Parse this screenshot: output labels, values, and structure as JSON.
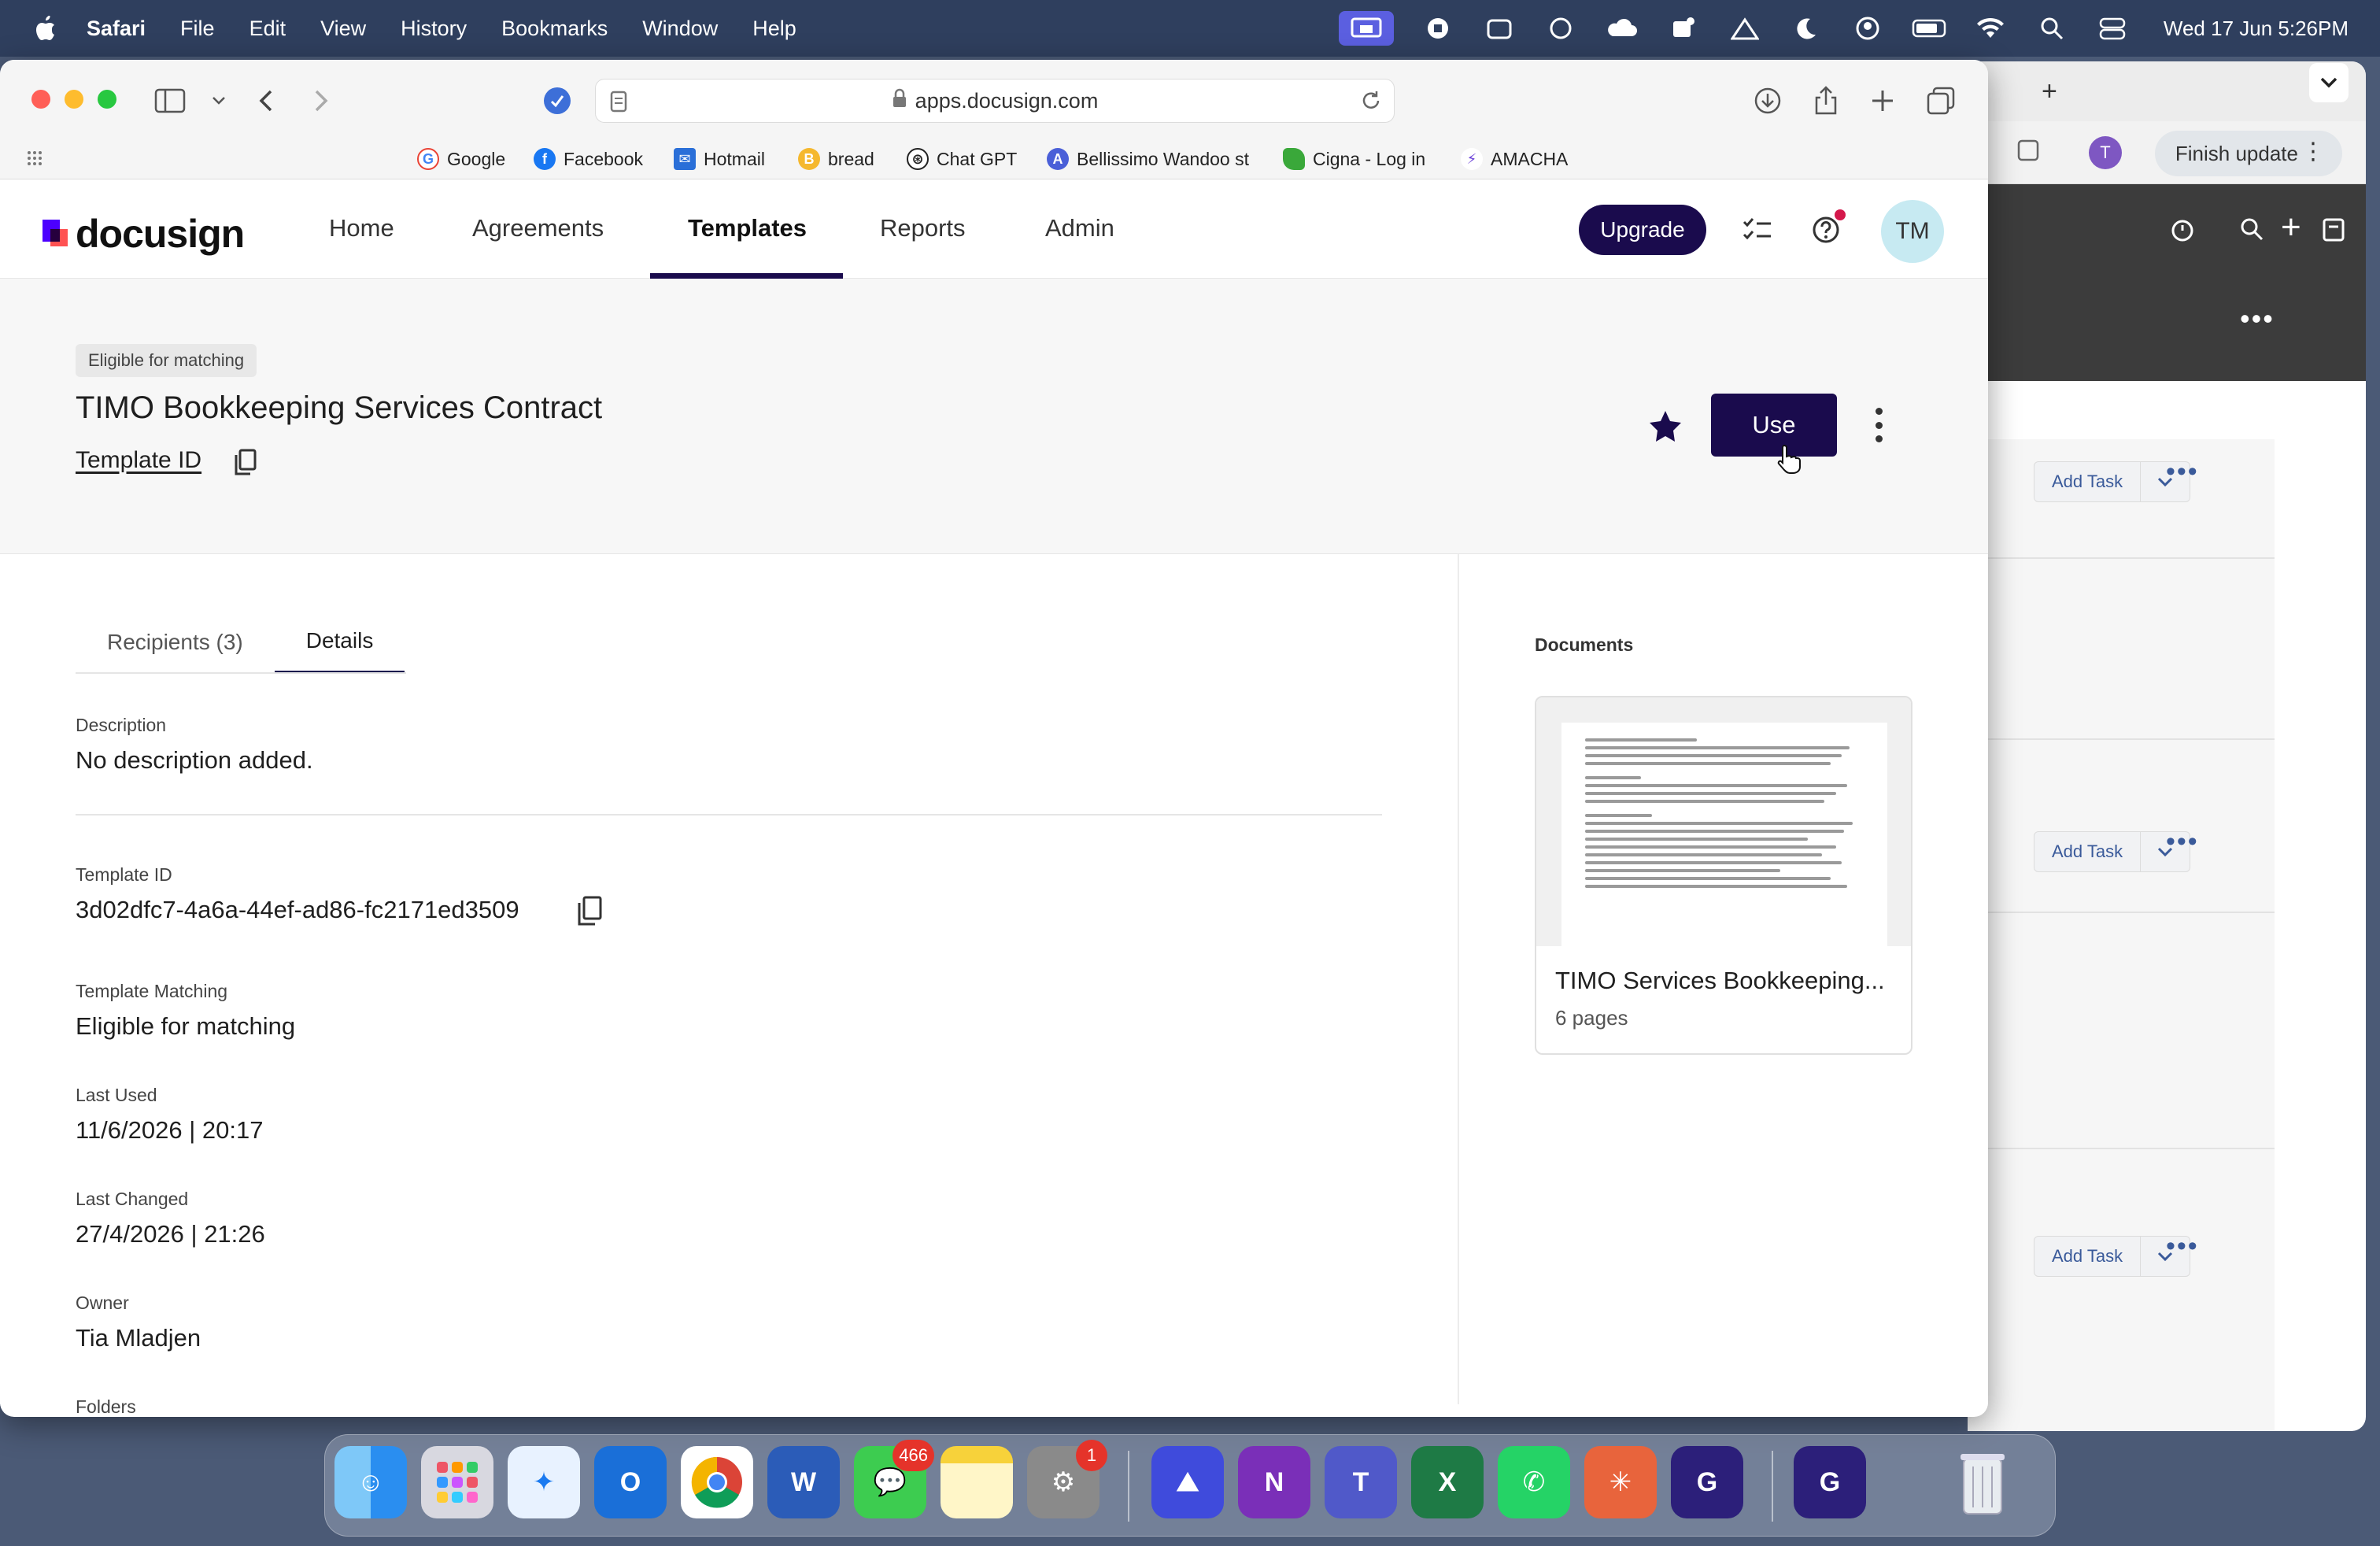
{
  "menubar": {
    "app": "Safari",
    "items": [
      "File",
      "Edit",
      "View",
      "History",
      "Bookmarks",
      "Window",
      "Help"
    ],
    "clock": "Wed 17 Jun  5:26PM"
  },
  "browser": {
    "url": "apps.docusign.com",
    "favorites": [
      "Google",
      "Facebook",
      "Hotmail",
      "bread",
      "Chat GPT",
      "Bellissimo Wandoo st",
      "Cigna - Log in",
      "AMACHA"
    ],
    "finish_update": "Finish update"
  },
  "app": {
    "logo": "docusign",
    "nav": [
      "Home",
      "Agreements",
      "Templates",
      "Reports",
      "Admin"
    ],
    "upgrade": "Upgrade",
    "avatar": "TM"
  },
  "template": {
    "badge": "Eligible for matching",
    "title": "TIMO Bookkeeping Services Contract",
    "template_id_link": "Template ID",
    "use_button": "Use"
  },
  "tabs": [
    "Recipients (3)",
    "Details"
  ],
  "details": {
    "description_label": "Description",
    "description_value": "No description added.",
    "template_id_label": "Template ID",
    "template_id_value": "3d02dfc7-4a6a-44ef-ad86-fc2171ed3509",
    "matching_label": "Template Matching",
    "matching_value": "Eligible for matching",
    "last_used_label": "Last Used",
    "last_used_value": "11/6/2026 | 20:17",
    "last_changed_label": "Last Changed",
    "last_changed_value": "27/4/2026 | 21:26",
    "owner_label": "Owner",
    "owner_value": "Tia Mladjen",
    "folders_label": "Folders"
  },
  "documents": {
    "label": "Documents",
    "name": "TIMO Services Bookkeeping...",
    "pages": "6 pages"
  },
  "background_window": {
    "add_task": "Add Task"
  },
  "dock": {
    "messages_badge": "466",
    "settings_badge": "1"
  }
}
